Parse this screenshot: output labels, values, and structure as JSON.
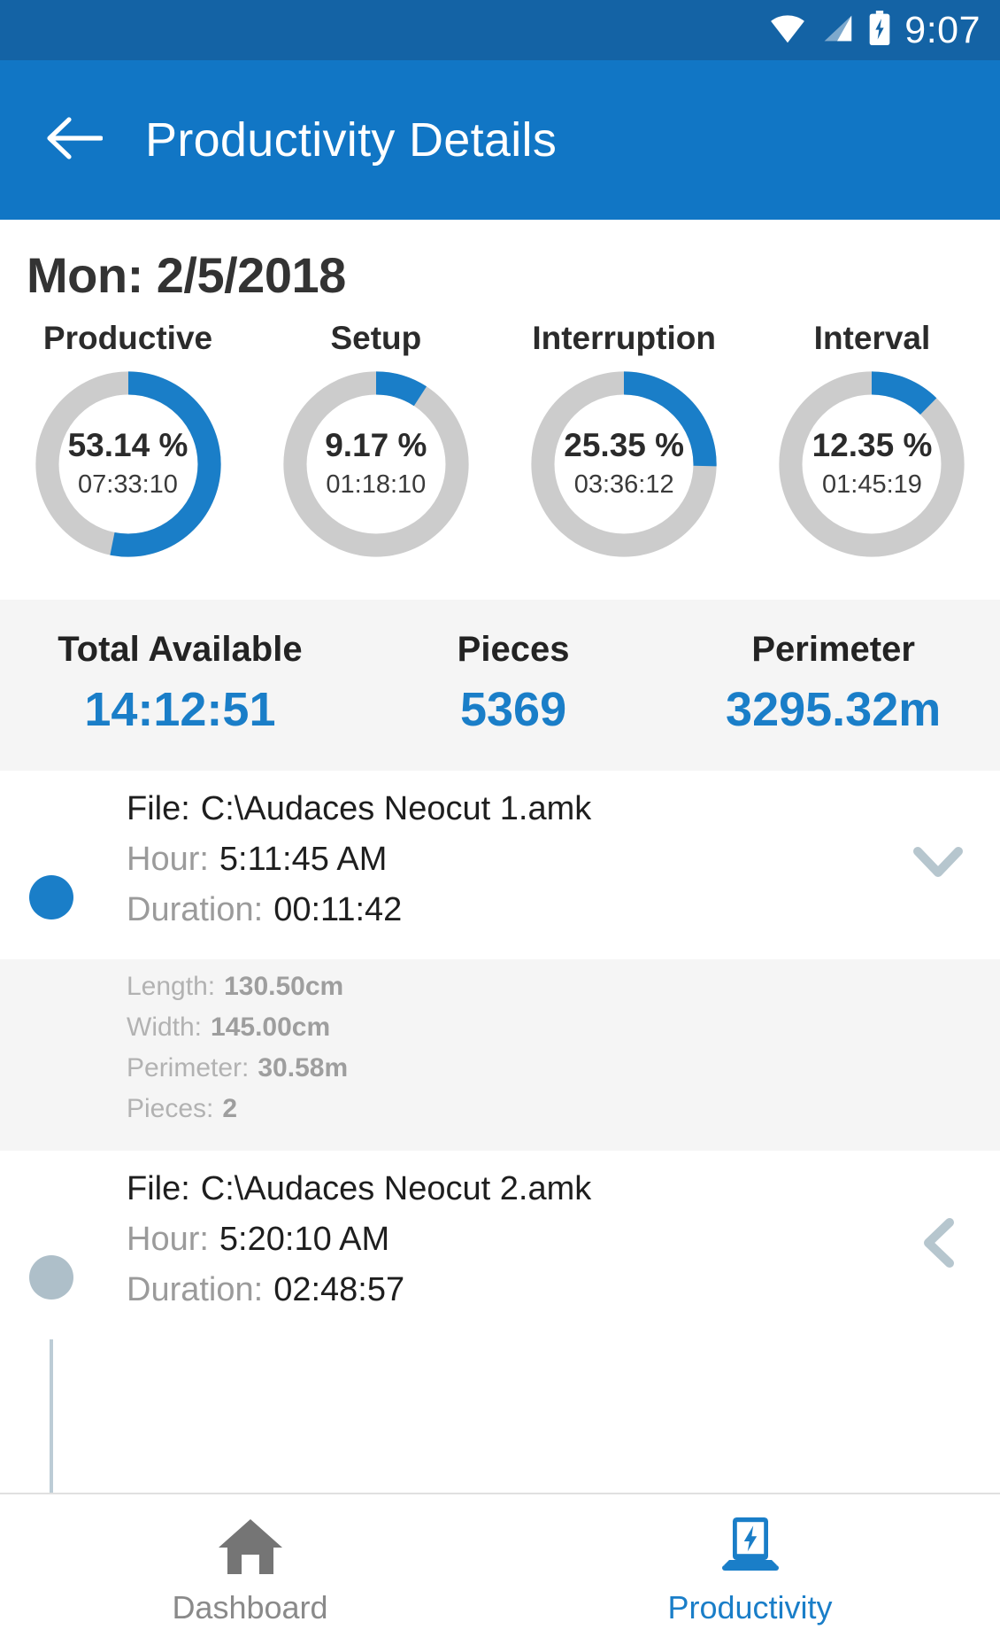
{
  "status_bar": {
    "time": "9:07",
    "icons": [
      "wifi-icon",
      "signal-icon",
      "battery-charging-icon"
    ],
    "bg_color": "#1463a5"
  },
  "app_bar": {
    "title": "Productivity Details",
    "back_icon": "arrow-left-icon",
    "bg_color": "#1176c5"
  },
  "page": {
    "date_heading": "Mon: 2/5/2018",
    "accent_color": "#1a7ec8",
    "track_color": "#cccccc"
  },
  "chart_data": {
    "type": "pie",
    "title": "Mon: 2/5/2018",
    "subtitle": "",
    "legend_position": "above-each",
    "categories": [
      "Productive",
      "Setup",
      "Interruption",
      "Interval"
    ],
    "values": [
      53.14,
      9.17,
      25.35,
      12.35
    ],
    "unit": "%",
    "durations": [
      "07:33:10",
      "01:18:10",
      "03:36:12",
      "01:45:19"
    ],
    "donut": true,
    "start_angle_deg": 0,
    "direction": "clockwise",
    "ylim": [
      0,
      100
    ],
    "series": [
      {
        "name": "Productive",
        "value": 53.14,
        "label": "53.14 %",
        "duration": "07:33:10"
      },
      {
        "name": "Setup",
        "value": 9.17,
        "label": "9.17 %",
        "duration": "01:18:10"
      },
      {
        "name": "Interruption",
        "value": 25.35,
        "label": "25.35 %",
        "duration": "03:36:12"
      },
      {
        "name": "Interval",
        "value": 12.35,
        "label": "12.35 %",
        "duration": "01:45:19"
      }
    ],
    "colors": {
      "filled": "#1a7ec8",
      "remainder": "#cccccc"
    }
  },
  "donuts": [
    {
      "label": "Productive",
      "percent": "53.14 %",
      "duration": "07:33:10",
      "value": 53.14
    },
    {
      "label": "Setup",
      "percent": "9.17 %",
      "duration": "01:18:10",
      "value": 9.17
    },
    {
      "label": "Interruption",
      "percent": "25.35 %",
      "duration": "03:36:12",
      "value": 25.35
    },
    {
      "label": "Interval",
      "percent": "12.35 %",
      "duration": "01:45:19",
      "value": 12.35
    }
  ],
  "stats": [
    {
      "label": "Total Available",
      "value": "14:12:51"
    },
    {
      "label": "Pieces",
      "value": "5369"
    },
    {
      "label": "Perimeter",
      "value": "3295.32m"
    }
  ],
  "timeline": {
    "entries": [
      {
        "state": "active",
        "chevron": "chevron-down-icon",
        "file_key": "File:",
        "file_value": "C:\\Audaces Neocut 1.amk",
        "hour_key": "Hour:",
        "hour_value": "5:11:45 AM",
        "duration_key": "Duration:",
        "duration_value": "00:11:42"
      },
      {
        "state": "inactive",
        "chevron": "chevron-left-icon",
        "file_key": "File:",
        "file_value": "C:\\Audaces Neocut 2.amk",
        "hour_key": "Hour:",
        "hour_value": "5:20:10 AM",
        "duration_key": "Duration:",
        "duration_value": "02:48:57"
      }
    ],
    "details": [
      {
        "key": "Length:",
        "value": "130.50cm"
      },
      {
        "key": "Width:",
        "value": "145.00cm"
      },
      {
        "key": "Perimeter:",
        "value": "30.58m"
      },
      {
        "key": "Pieces:",
        "value": "2"
      }
    ]
  },
  "bottom_nav": [
    {
      "label": "Dashboard",
      "icon": "home-icon",
      "active": false
    },
    {
      "label": "Productivity",
      "icon": "laptop-bolt-icon",
      "active": true
    }
  ]
}
